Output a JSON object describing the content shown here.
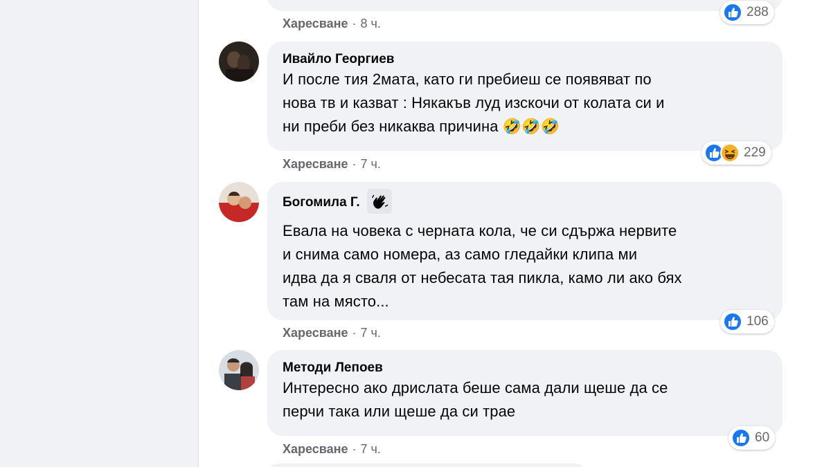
{
  "colors": {
    "bubble": "#f0f2f5",
    "secondary_text": "#65676b",
    "like_blue": "#1877f2",
    "haha_yellow": "#f7b125"
  },
  "top_comment": {
    "like_label": "Харесване",
    "time": "8 ч.",
    "reaction_count": "288",
    "reactions": [
      "like-icon"
    ]
  },
  "comments": [
    {
      "author": "Ивайло Георгиев",
      "text_lines": [
        "И после тия 2мата, като ги пребиеш се появяват по",
        "нова тв и казват : Някакъв луд изскочи от колата си и",
        "ни преби без никаква причина 🤣🤣🤣"
      ],
      "like_label": "Харесване",
      "time": "7 ч.",
      "reaction_count": "229",
      "reactions": [
        "like-icon",
        "haha-icon"
      ]
    },
    {
      "author": "Богомила Г.",
      "badge_icon": "waving-hand-icon",
      "text_lines": [
        "Евала на човека с черната кола, че си сдържа нервите",
        "и снима само номера, аз само гледайки клипа ми",
        "идва да я сваля от небесата тая пикла, камо ли ако бях",
        "там на място..."
      ],
      "like_label": "Харесване",
      "time": "7 ч.",
      "reaction_count": "106",
      "reactions": [
        "like-icon"
      ]
    },
    {
      "author": "Методи Лепоев",
      "text_lines": [
        "Интересно ако дрислата беше сама дали щеше да се",
        "перчи така или щеше да си трае"
      ],
      "like_label": "Харесване",
      "time": "7 ч.",
      "reaction_count": "60",
      "reactions": [
        "like-icon"
      ]
    }
  ]
}
